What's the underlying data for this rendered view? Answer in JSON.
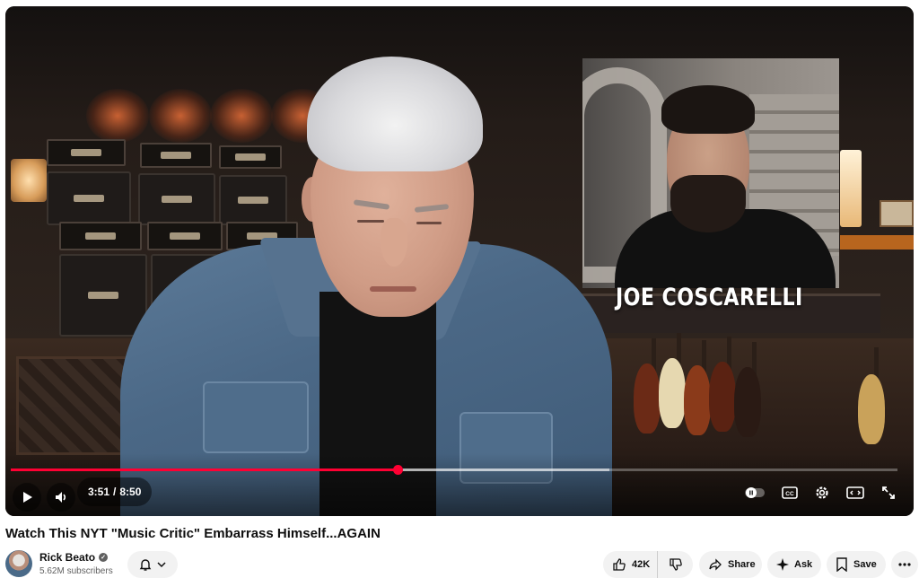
{
  "player": {
    "overlay_name": "JOE COSCARELLI",
    "time_current": "3:51",
    "time_separator": "/",
    "time_total": "8:50",
    "progress_played": 0.436,
    "progress_buffered": 0.675,
    "accent_color": "#ff0033",
    "icons": {
      "play": "play-icon",
      "volume": "volume-icon",
      "autoplay": "autoplay-toggle-icon",
      "captions": "captions-icon",
      "settings": "gear-icon",
      "theater": "theater-mode-icon",
      "fullscreen": "fullscreen-icon"
    }
  },
  "video": {
    "title": "Watch This NYT \"Music Critic\" Embarrass Himself...AGAIN"
  },
  "channel": {
    "name": "Rick Beato",
    "subscribers": "5.62M subscribers"
  },
  "actions": {
    "likes": "42K",
    "share": "Share",
    "ask": "Ask",
    "save": "Save"
  }
}
